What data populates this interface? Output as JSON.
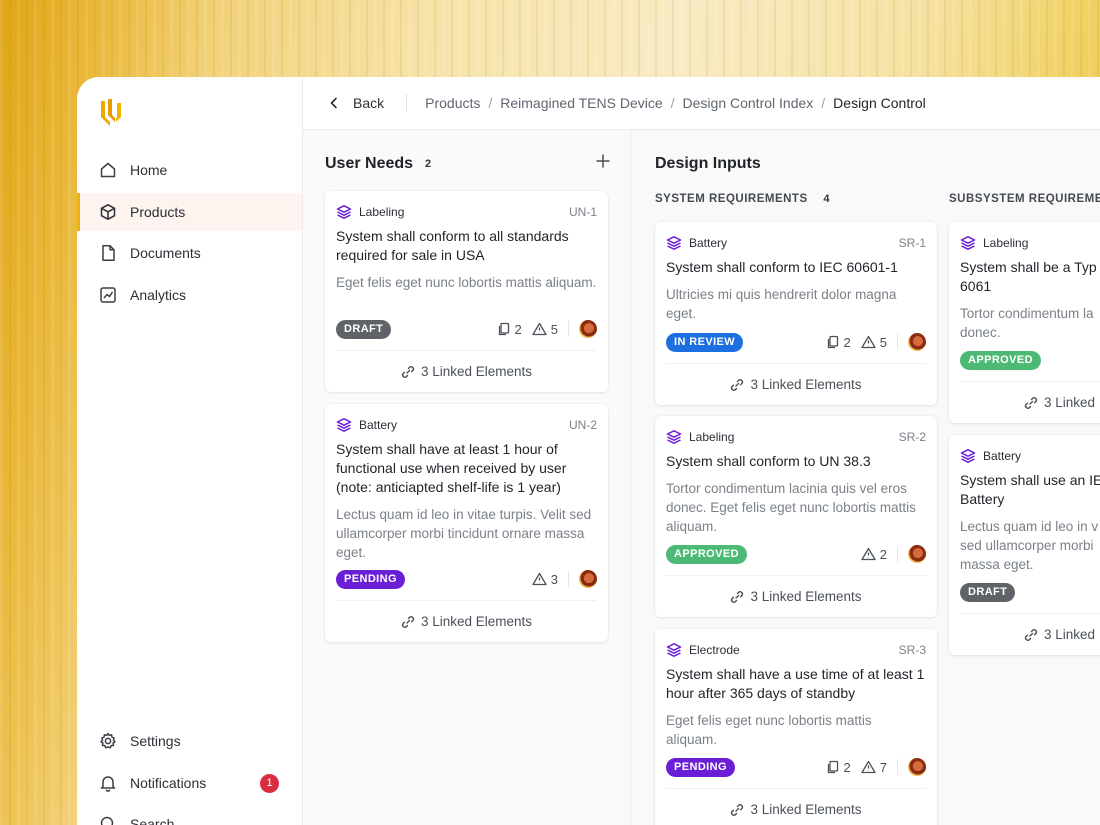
{
  "breadcrumb": {
    "back": "Back",
    "items": [
      "Products",
      "Reimagined TENS Device",
      "Design Control Index",
      "Design Control"
    ]
  },
  "sidebar": {
    "items": [
      {
        "label": "Home",
        "icon": "home-icon"
      },
      {
        "label": "Products",
        "icon": "box-icon"
      },
      {
        "label": "Documents",
        "icon": "document-icon"
      },
      {
        "label": "Analytics",
        "icon": "chart-icon"
      }
    ],
    "bottom": [
      {
        "label": "Settings",
        "icon": "gear-icon"
      },
      {
        "label": "Notifications",
        "icon": "bell-icon",
        "badge": "1"
      },
      {
        "label": "Search",
        "icon": "search-icon"
      }
    ]
  },
  "user_needs": {
    "title": "User Needs",
    "count": "2",
    "cards": [
      {
        "category": "Labeling",
        "id": "UN-1",
        "title": "System shall conform to all standards required for sale in USA",
        "desc": "Eget felis eget nunc lobortis mattis aliquam.",
        "status": "DRAFT",
        "docs": "2",
        "warnings": "5",
        "linked": "3 Linked Elements"
      },
      {
        "category": "Battery",
        "id": "UN-2",
        "title": "System shall have at least 1 hour of functional use when received by user (note: anticiapted shelf-life is 1 year)",
        "desc": "Lectus quam id leo in vitae turpis. Velit sed ullamcorper morbi tincidunt ornare massa eget.",
        "status": "PENDING",
        "warnings": "3",
        "linked": "3 Linked Elements"
      }
    ]
  },
  "design_inputs": {
    "title": "Design Inputs",
    "system": {
      "title": "SYSTEM REQUIREMENTS",
      "count": "4",
      "cards": [
        {
          "category": "Battery",
          "id": "SR-1",
          "title": "System shall conform to IEC 60601-1",
          "desc": "Ultricies mi quis hendrerit dolor magna eget.",
          "status": "IN REVIEW",
          "docs": "2",
          "warnings": "5",
          "linked": "3 Linked Elements"
        },
        {
          "category": "Labeling",
          "id": "SR-2",
          "title": "System shall conform to UN 38.3",
          "desc": "Tortor condimentum lacinia quis vel eros donec. Eget felis eget nunc lobortis mattis aliquam.",
          "status": "APPROVED",
          "warnings": "2",
          "linked": "3 Linked Elements"
        },
        {
          "category": "Electrode",
          "id": "SR-3",
          "title": "System shall have a use time of at least 1 hour after 365 days of standby",
          "desc": "Eget felis eget nunc lobortis mattis aliquam.",
          "status": "PENDING",
          "docs": "2",
          "warnings": "7",
          "linked": "3 Linked Elements"
        }
      ]
    },
    "subsystem": {
      "title": "SUBSYSTEM REQUIREMEN",
      "cards": [
        {
          "category": "Labeling",
          "title": "System shall be a Typ",
          "title2": "6061",
          "desc": "Tortor condimentum la",
          "desc2": "donec.",
          "status": "APPROVED",
          "linked": "3 Linked"
        },
        {
          "category": "Battery",
          "title": "System shall use an IE",
          "title2": "Battery",
          "desc": "Lectus quam id leo in v",
          "desc2": "sed ullamcorper morbi",
          "desc3": "massa eget.",
          "status": "DRAFT",
          "linked": "3 Linked"
        }
      ]
    }
  },
  "colors": {
    "accent": "#f0b400",
    "draft": "#5f6368",
    "in_review": "#1b6fe0",
    "approved": "#4cba74",
    "pending": "#6a1fd6",
    "category_icon": "#6a1fd6",
    "notification": "#d92d3f"
  }
}
